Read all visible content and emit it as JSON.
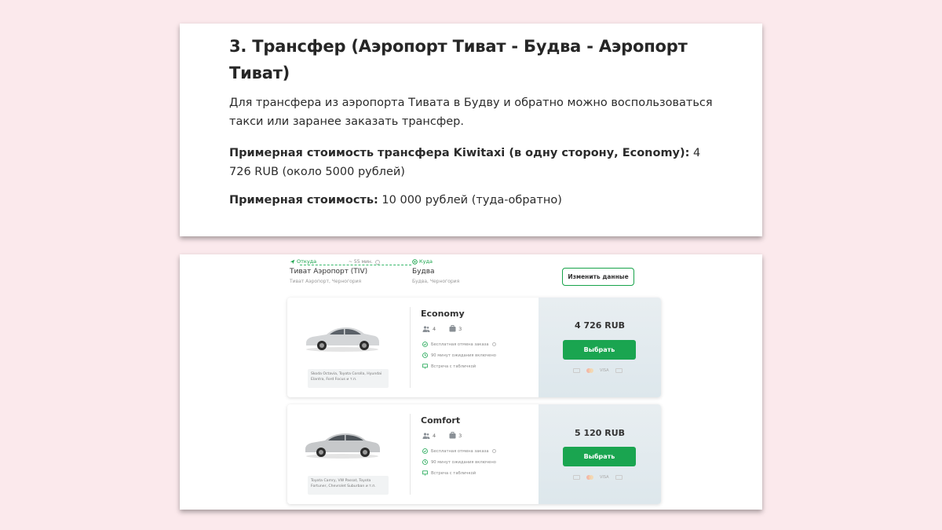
{
  "article": {
    "heading": "3. Трансфер (Аэропорт Тиват - Будва - Аэропорт Тиват)",
    "intro": "Для трансфера из аэропорта Тивата в Будву и обратно можно воспользоваться такси или заранее заказать трансфер.",
    "cost_kiwitaxi_label": "Примерная стоимость трансфера Kiwitaxi (в одну сторону, Economy):",
    "cost_kiwitaxi_value": " 4 726 RUB (около 5000 рублей)",
    "cost_approx_label": "Примерная стоимость:",
    "cost_approx_value": " 10 000 рублей (туда-обратно)"
  },
  "route": {
    "from_label": "Откуда",
    "from_city": "Тиват Аэропорт (TIV)",
    "from_sub": "Тиват Аэропорт, Черногория",
    "to_label": "Куда",
    "to_city": "Будва",
    "to_sub": "Будва, Черногория",
    "duration": "~ 55 мин.",
    "change_button": "Изменить данные"
  },
  "offers": [
    {
      "class": "Economy",
      "passengers": "4",
      "luggage": "3",
      "features": [
        "Бесплатная отмена заказа",
        "90 минут ожидания включено",
        "Встреча с табличкой"
      ],
      "models": "Skoda Octavia, Toyota Corolla, Hyundai Elantra, Ford Focus и т.п.",
      "price": "4 726 RUB",
      "button": "Выбрать",
      "pay_visa": "VISA",
      "car_color": "#d4d6d8"
    },
    {
      "class": "Comfort",
      "passengers": "4",
      "luggage": "3",
      "features": [
        "Бесплатная отмена заказа",
        "90 минут ожидания включено",
        "Встреча с табличкой"
      ],
      "models": "Toyota Camry, VW Passat, Toyota Fortuner, Chevrolet Suburban и т.п.",
      "price": "5 120 RUB",
      "button": "Выбрать",
      "pay_visa": "VISA",
      "car_color": "#c6c8ca"
    }
  ],
  "colors": {
    "accent_green": "#1aa550",
    "page_bg": "#fbe9ec"
  }
}
